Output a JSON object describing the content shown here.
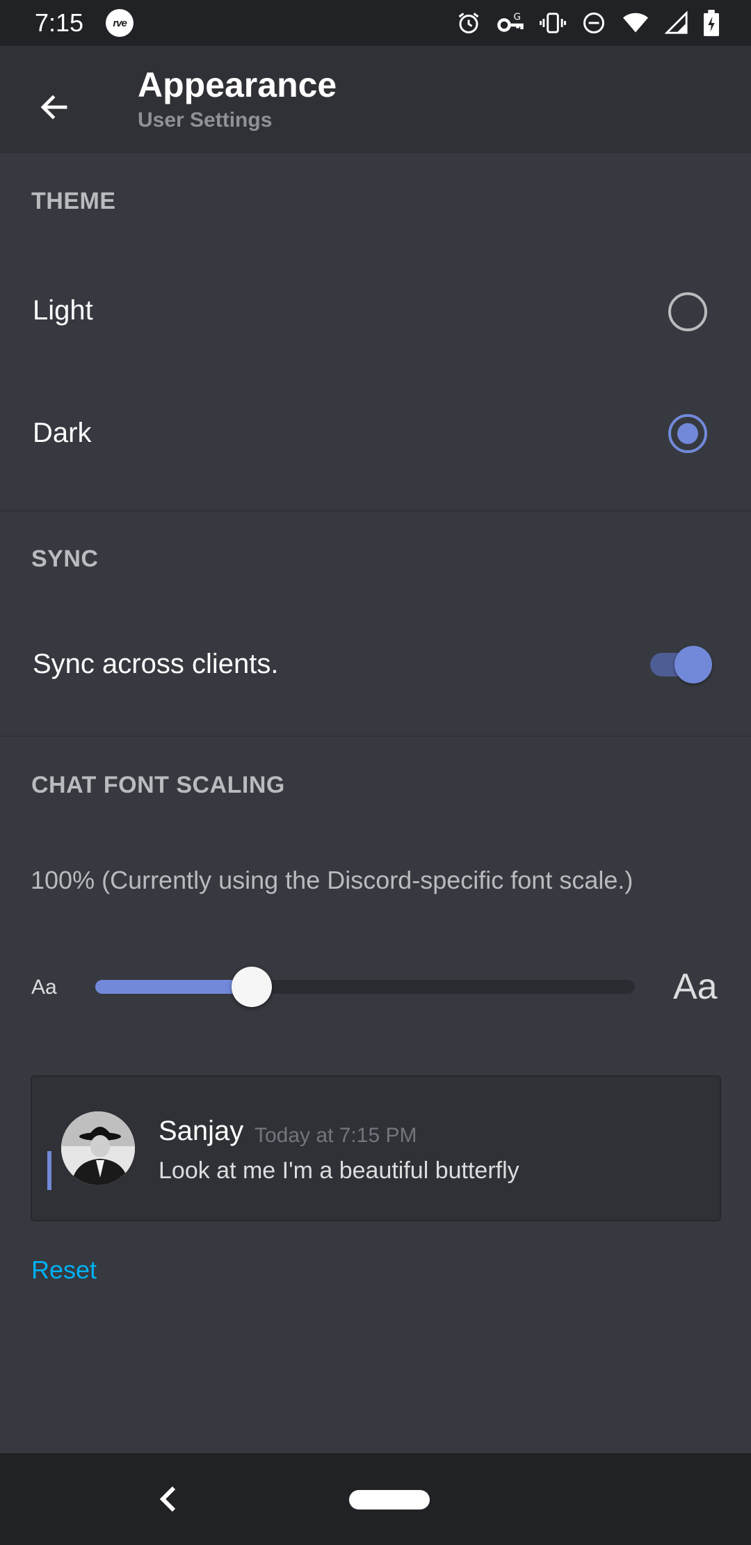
{
  "status_bar": {
    "time": "7:15",
    "app_icon_label": "rve",
    "icons": [
      "alarm-icon",
      "vpn-key-icon",
      "vibrate-icon",
      "do-not-disturb-icon",
      "wifi-icon",
      "cell-signal-icon",
      "battery-charging-icon"
    ]
  },
  "toolbar": {
    "title": "Appearance",
    "subtitle": "User Settings",
    "back_icon": "arrow-left-icon"
  },
  "theme": {
    "header": "THEME",
    "options": [
      {
        "label": "Light",
        "selected": false
      },
      {
        "label": "Dark",
        "selected": true
      }
    ]
  },
  "sync": {
    "header": "SYNC",
    "label": "Sync across clients.",
    "enabled": true
  },
  "font_scaling": {
    "header": "CHAT FONT SCALING",
    "description": "100% (Currently using the Discord-specific font scale.)",
    "small_label": "Aa",
    "large_label": "Aa",
    "slider_value": 0.29
  },
  "preview": {
    "username": "Sanjay",
    "timestamp": "Today at 7:15 PM",
    "message": "Look at me I'm a beautiful butterfly"
  },
  "reset_label": "Reset",
  "colors": {
    "background": "#36393f",
    "toolbar": "#2f3136",
    "accent": "#7289da",
    "link": "#00b0f4"
  }
}
